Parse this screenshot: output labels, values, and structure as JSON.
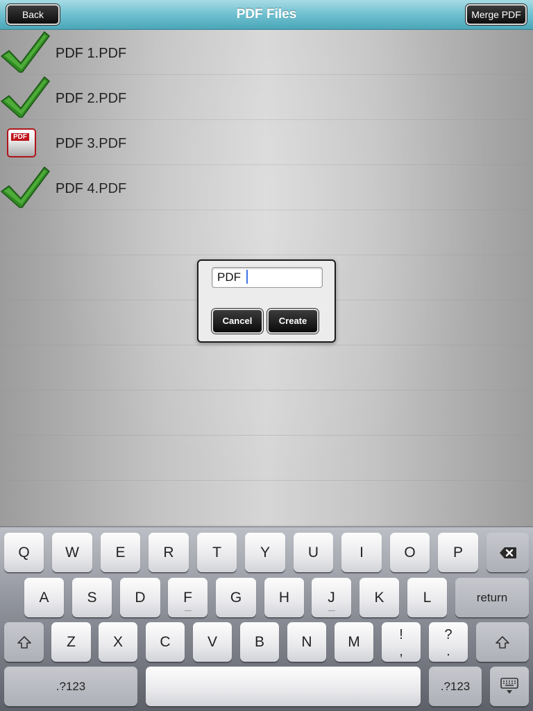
{
  "navbar": {
    "title": "PDF Files",
    "back_label": "Back",
    "merge_label": "Merge PDF"
  },
  "files": [
    {
      "name": "PDF 1.PDF",
      "icon": "checkmark-icon",
      "selected": true
    },
    {
      "name": "PDF 2.PDF",
      "icon": "checkmark-icon",
      "selected": true
    },
    {
      "name": "PDF 3.PDF",
      "icon": "pdf-file-icon",
      "selected": false,
      "badge": "PDF"
    },
    {
      "name": "PDF 4.PDF",
      "icon": "checkmark-icon",
      "selected": true
    }
  ],
  "dialog": {
    "input_value": "PDF ",
    "cancel_label": "Cancel",
    "create_label": "Create"
  },
  "keyboard": {
    "row1": [
      "Q",
      "W",
      "E",
      "R",
      "T",
      "Y",
      "U",
      "I",
      "O",
      "P"
    ],
    "row2": [
      "A",
      "S",
      "D",
      "F",
      "G",
      "H",
      "J",
      "K",
      "L"
    ],
    "row3": [
      "Z",
      "X",
      "C",
      "V",
      "B",
      "N",
      "M"
    ],
    "return_label": "return",
    "num_label": ".?123",
    "excl_top": "!",
    "excl_bot": ",",
    "ques_top": "?",
    "ques_bot": "."
  },
  "colors": {
    "navbar": "#6fc0d0",
    "check_green": "#2f8a22",
    "pdf_red": "#c1131b",
    "caret": "#3d74e6"
  }
}
